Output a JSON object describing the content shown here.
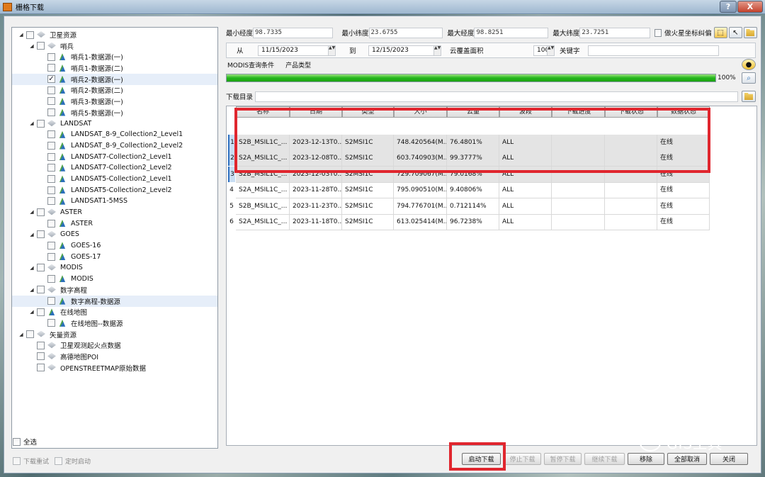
{
  "window": {
    "title": "栅格下载",
    "help": "?",
    "close": "X"
  },
  "tree": {
    "items": [
      {
        "label": "卫星资源",
        "level": 0,
        "exp": "◢",
        "icon": "layer",
        "checked": false
      },
      {
        "label": "哨兵",
        "level": 1,
        "exp": "◢",
        "icon": "layer",
        "checked": false
      },
      {
        "label": "哨兵1-数据源(一)",
        "level": 2,
        "exp": "",
        "icon": "leaf",
        "checked": false
      },
      {
        "label": "哨兵1-数据源(二)",
        "level": 2,
        "exp": "",
        "icon": "leaf",
        "checked": false
      },
      {
        "label": "哨兵2-数据源(一)",
        "level": 2,
        "exp": "",
        "icon": "leaf",
        "checked": true,
        "selected": true
      },
      {
        "label": "哨兵2-数据源(二)",
        "level": 2,
        "exp": "",
        "icon": "leaf",
        "checked": false
      },
      {
        "label": "哨兵3-数据源(一)",
        "level": 2,
        "exp": "",
        "icon": "leaf",
        "checked": false
      },
      {
        "label": "哨兵5-数据源(一)",
        "level": 2,
        "exp": "",
        "icon": "leaf",
        "checked": false
      },
      {
        "label": "LANDSAT",
        "level": 1,
        "exp": "◢",
        "icon": "layer",
        "checked": false
      },
      {
        "label": "LANDSAT_8-9_Collection2_Level1",
        "level": 2,
        "exp": "",
        "icon": "leaf",
        "checked": false
      },
      {
        "label": "LANDSAT_8-9_Collection2_Level2",
        "level": 2,
        "exp": "",
        "icon": "leaf",
        "checked": false
      },
      {
        "label": "LANDSAT7-Collection2_Level1",
        "level": 2,
        "exp": "",
        "icon": "leaf",
        "checked": false
      },
      {
        "label": "LANDSAT7-Collection2_Level2",
        "level": 2,
        "exp": "",
        "icon": "leaf",
        "checked": false
      },
      {
        "label": "LANDSAT5-Collection2_Level1",
        "level": 2,
        "exp": "",
        "icon": "leaf",
        "checked": false
      },
      {
        "label": "LANDSAT5-Collection2_Level2",
        "level": 2,
        "exp": "",
        "icon": "leaf",
        "checked": false
      },
      {
        "label": "LANDSAT1-5MSS",
        "level": 2,
        "exp": "",
        "icon": "leaf",
        "checked": false
      },
      {
        "label": "ASTER",
        "level": 1,
        "exp": "◢",
        "icon": "layer",
        "checked": false
      },
      {
        "label": "ASTER",
        "level": 2,
        "exp": "",
        "icon": "leaf",
        "checked": false
      },
      {
        "label": "GOES",
        "level": 1,
        "exp": "◢",
        "icon": "layer",
        "checked": false
      },
      {
        "label": "GOES-16",
        "level": 2,
        "exp": "",
        "icon": "leaf",
        "checked": false
      },
      {
        "label": "GOES-17",
        "level": 2,
        "exp": "",
        "icon": "leaf",
        "checked": false
      },
      {
        "label": "MODIS",
        "level": 1,
        "exp": "◢",
        "icon": "layer",
        "checked": false
      },
      {
        "label": "MODIS",
        "level": 2,
        "exp": "",
        "icon": "leaf",
        "checked": false
      },
      {
        "label": "数字高程",
        "level": 1,
        "exp": "◢",
        "icon": "layer",
        "checked": false
      },
      {
        "label": "数字高程-数据源",
        "level": 2,
        "exp": "",
        "icon": "leaf",
        "checked": false,
        "selected": true
      },
      {
        "label": "在线地图",
        "level": 1,
        "exp": "◢",
        "icon": "leaf",
        "checked": false
      },
      {
        "label": "在线地图--数据源",
        "level": 2,
        "exp": "",
        "icon": "leaf",
        "checked": false
      },
      {
        "label": "矢量资源",
        "level": 0,
        "exp": "◢",
        "icon": "layer",
        "checked": false
      },
      {
        "label": "卫星观测起火点数据",
        "level": 1,
        "exp": "",
        "icon": "layer",
        "checked": false
      },
      {
        "label": "高德地图POI",
        "level": 1,
        "exp": "",
        "icon": "layer",
        "checked": false
      },
      {
        "label": "OPENSTREETMAP原始数据",
        "level": 1,
        "exp": "",
        "icon": "layer",
        "checked": false
      }
    ],
    "select_all": "全选"
  },
  "bbox": {
    "min_lon_label": "最小经度",
    "min_lon": "98.7335",
    "min_lat_label": "最小纬度",
    "min_lat": "23.6755",
    "max_lon_label": "最大经度",
    "max_lon": "98.8251",
    "max_lat_label": "最大纬度",
    "max_lat": "23.7251",
    "mars_label": "做火星坐标纠偏"
  },
  "query": {
    "from_label": "从",
    "from_date": "11/15/2023",
    "to_label": "到",
    "to_date": "12/15/2023",
    "cloud_label": "云覆盖面积",
    "cloud_value": "100",
    "keyword_label": "关键字",
    "keyword_value": ""
  },
  "modis": {
    "label": "MODIS查询条件",
    "product_label": "产品类型"
  },
  "progress": {
    "value": 1.0,
    "text": "100%"
  },
  "download_dir": {
    "label": "下载目录",
    "value": ""
  },
  "table": {
    "headers": [
      "名称",
      "日期",
      "类型",
      "大小",
      "云量",
      "波段",
      "下载进度",
      "下载状态",
      "数据状态"
    ],
    "rows": [
      {
        "n": "1",
        "c": [
          "S2B_MSIL1C_...",
          "2023-12-13T0...",
          "S2MSI1C",
          "748.420564(M...",
          "76.4801%",
          "ALL",
          "",
          "",
          "在线"
        ],
        "hl": true
      },
      {
        "n": "2",
        "c": [
          "S2A_MSIL1C_...",
          "2023-12-08T0...",
          "S2MSI1C",
          "603.740903(M...",
          "99.3777%",
          "ALL",
          "",
          "",
          "在线"
        ],
        "hl": true
      },
      {
        "n": "3",
        "c": [
          "S2B_MSIL1C_...",
          "2023-12-03T0...",
          "S2MSI1C",
          "729.709067(M...",
          "79.0168%",
          "ALL",
          "",
          "",
          "在线"
        ],
        "hl": true
      },
      {
        "n": "4",
        "c": [
          "S2A_MSIL1C_...",
          "2023-11-28T0...",
          "S2MSI1C",
          "795.090510(M...",
          "9.40806%",
          "ALL",
          "",
          "",
          "在线"
        ],
        "hl": false
      },
      {
        "n": "5",
        "c": [
          "S2B_MSIL1C_...",
          "2023-11-23T0...",
          "S2MSI1C",
          "794.776701(M...",
          "0.712114%",
          "ALL",
          "",
          "",
          "在线"
        ],
        "hl": false
      },
      {
        "n": "6",
        "c": [
          "S2A_MSIL1C_...",
          "2023-11-18T0...",
          "S2MSI1C",
          "613.025414(M...",
          "96.7238%",
          "ALL",
          "",
          "",
          "在线"
        ],
        "hl": false
      }
    ]
  },
  "options": {
    "retry_label": "下载重试",
    "timer_label": "定时启动"
  },
  "buttons": {
    "start": "启动下载",
    "stop": "停止下载",
    "pause": "暂停下载",
    "resume": "继续下载",
    "remove": "移除",
    "cancel_all": "全部取消",
    "close": "关闭"
  },
  "watermark": {
    "text": "GIS工具"
  },
  "colors": {
    "progress": "#23b71b",
    "highlight": "#e0262e"
  }
}
